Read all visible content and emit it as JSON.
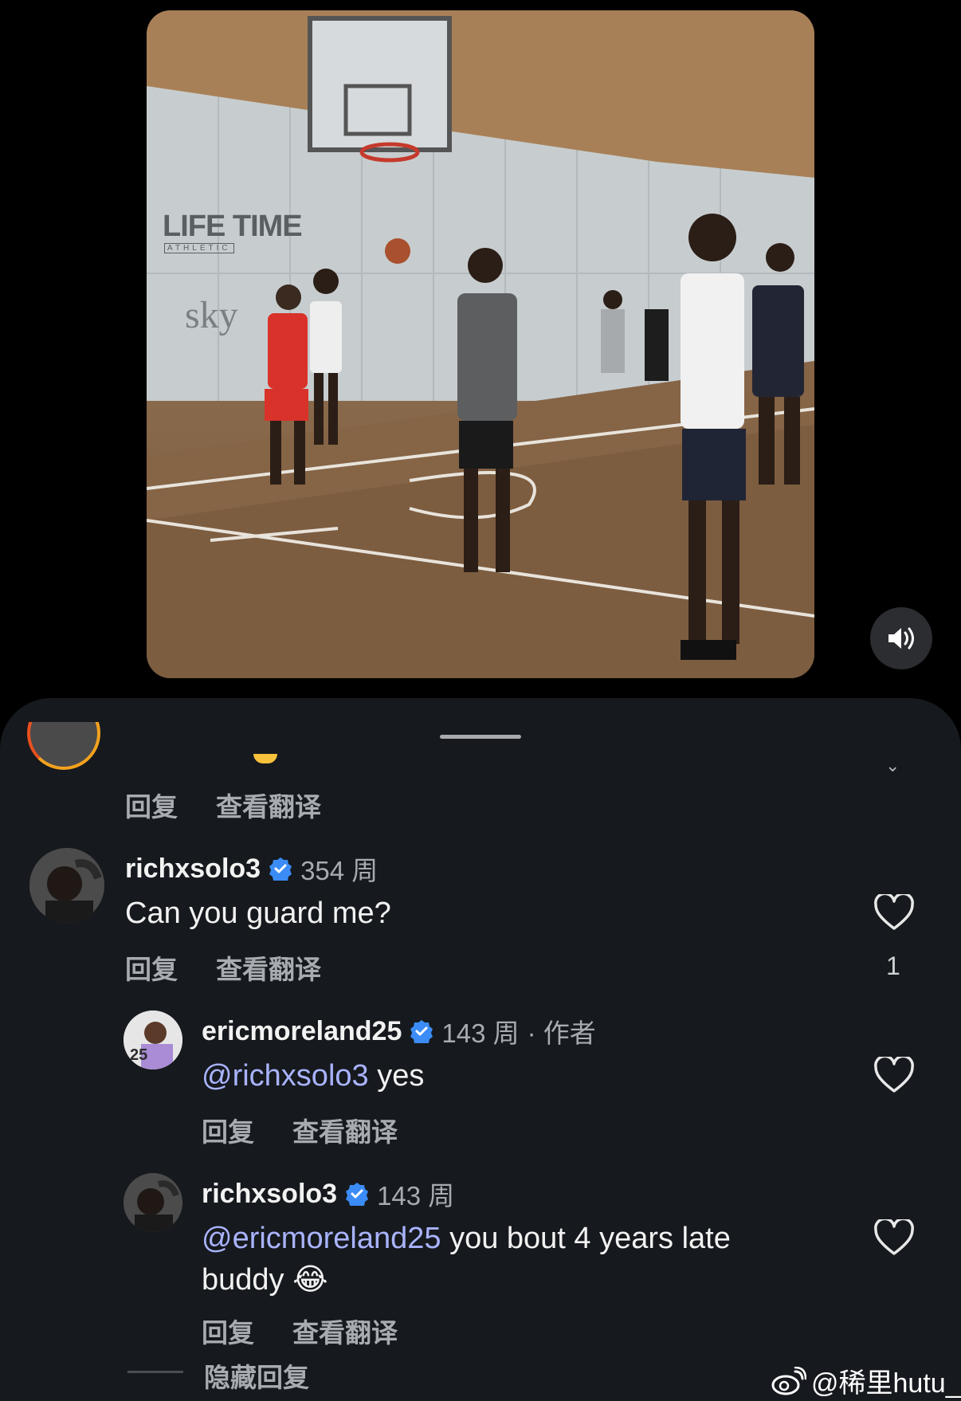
{
  "video": {
    "sign_line1": "LIFE TIME",
    "sign_line2": "ATHLETIC",
    "sign_line3": "sky"
  },
  "actions": {
    "reply": "回复",
    "translate": "查看翻译"
  },
  "comments": [
    {
      "username": "richxsolo3",
      "time": "354 周",
      "text": "Can you guard me?",
      "likes": "1"
    }
  ],
  "replies": [
    {
      "username": "ericmoreland25",
      "time": "143 周",
      "author_tag": "· 作者",
      "mention": "@richxsolo3",
      "text": "yes"
    },
    {
      "username": "richxsolo3",
      "time": "143 周",
      "mention": "@ericmoreland25",
      "text_line1": "you bout 4 years late",
      "text_line2": "buddy 😂"
    }
  ],
  "hide_replies": "隐藏回复",
  "watermark": "@稀里hutu_",
  "colors": {
    "sheet": "#16191d",
    "mention": "#a9b3ff",
    "verified": "#3b8cf6",
    "muted": "#a8abb0"
  }
}
